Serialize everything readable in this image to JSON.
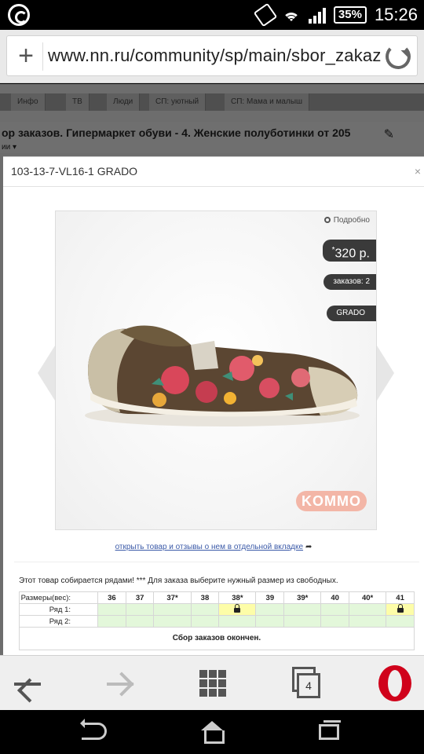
{
  "status_bar": {
    "battery": "35%",
    "time": "15:26",
    "icons": [
      "whatsapp-icon",
      "vibrate-icon",
      "wifi-icon",
      "signal-icon",
      "battery-icon"
    ]
  },
  "url_bar": {
    "url": "www.nn.ru/community/sp/main/sbor_zakaz"
  },
  "background_page": {
    "nav_tabs": [
      "Инфо",
      "ТВ",
      "Люди",
      "СП: уютный",
      "СП: Мама и малыш"
    ],
    "heading": "ор заказов. Гипермаркет обуви - 4. Женские полуботинки от 205",
    "sub": "ии ▾"
  },
  "modal": {
    "title": "103-13-7-VL16-1 GRADO",
    "close": "×",
    "details_link": "Подробно",
    "price": "320 р.",
    "price_mark": "*",
    "orders": "заказов: 2",
    "brand": "GRADO",
    "logo_text": "KOMMO",
    "open_link": "открыть товар и отзывы о нем в отдельной вкладке",
    "note": "Этот товар собирается рядами! *** Для заказа выберите нужный размер из свободных.",
    "sizes_header_label": "Размеры(вес):",
    "sizes": [
      "36",
      "37",
      "37*",
      "38",
      "38*",
      "39",
      "39*",
      "40",
      "40*",
      "41"
    ],
    "rows": [
      {
        "label": "Ряд 1:",
        "taken": [
          false,
          false,
          false,
          false,
          true,
          false,
          false,
          false,
          false,
          true
        ]
      },
      {
        "label": "Ряд 2:",
        "taken": [
          false,
          false,
          false,
          false,
          false,
          false,
          false,
          false,
          false,
          false
        ]
      }
    ],
    "closed_text": "Сбор заказов окончен."
  },
  "toolbar": {
    "tabs_count": "4"
  },
  "colors": {
    "free_cell": "#e3f7da",
    "taken_cell": "#fdfda8",
    "badge": "#3a3a3a",
    "link": "#3b5aa8",
    "opera": "#d0021b"
  }
}
